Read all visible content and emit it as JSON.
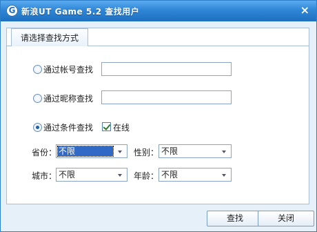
{
  "window": {
    "title": "新浪UT Game 5.2  查找用户",
    "app_icon": "G",
    "close_icon": "close-icon",
    "close_glyph": "×"
  },
  "tab": {
    "label": "请选择查找方式"
  },
  "search_modes": [
    {
      "label": "通过帐号查找",
      "checked": false,
      "input_value": ""
    },
    {
      "label": "通过昵称查找",
      "checked": false,
      "input_value": ""
    },
    {
      "label": "通过条件查找",
      "checked": true
    }
  ],
  "online": {
    "label": "在线",
    "checked": true
  },
  "filters": {
    "province": {
      "label": "省份：",
      "value": "不限"
    },
    "gender": {
      "label": "性别：",
      "value": "不限"
    },
    "city": {
      "label": "城市：",
      "value": "不限"
    },
    "age": {
      "label": "年龄：",
      "value": "不限"
    }
  },
  "buttons": {
    "search": "查找",
    "close": "关闭"
  },
  "colors": {
    "titlebar": "#2f86d6",
    "dialog_bg": "#e6f0f9",
    "panel_border": "#a7bfd6",
    "selection": "#316ac5"
  }
}
